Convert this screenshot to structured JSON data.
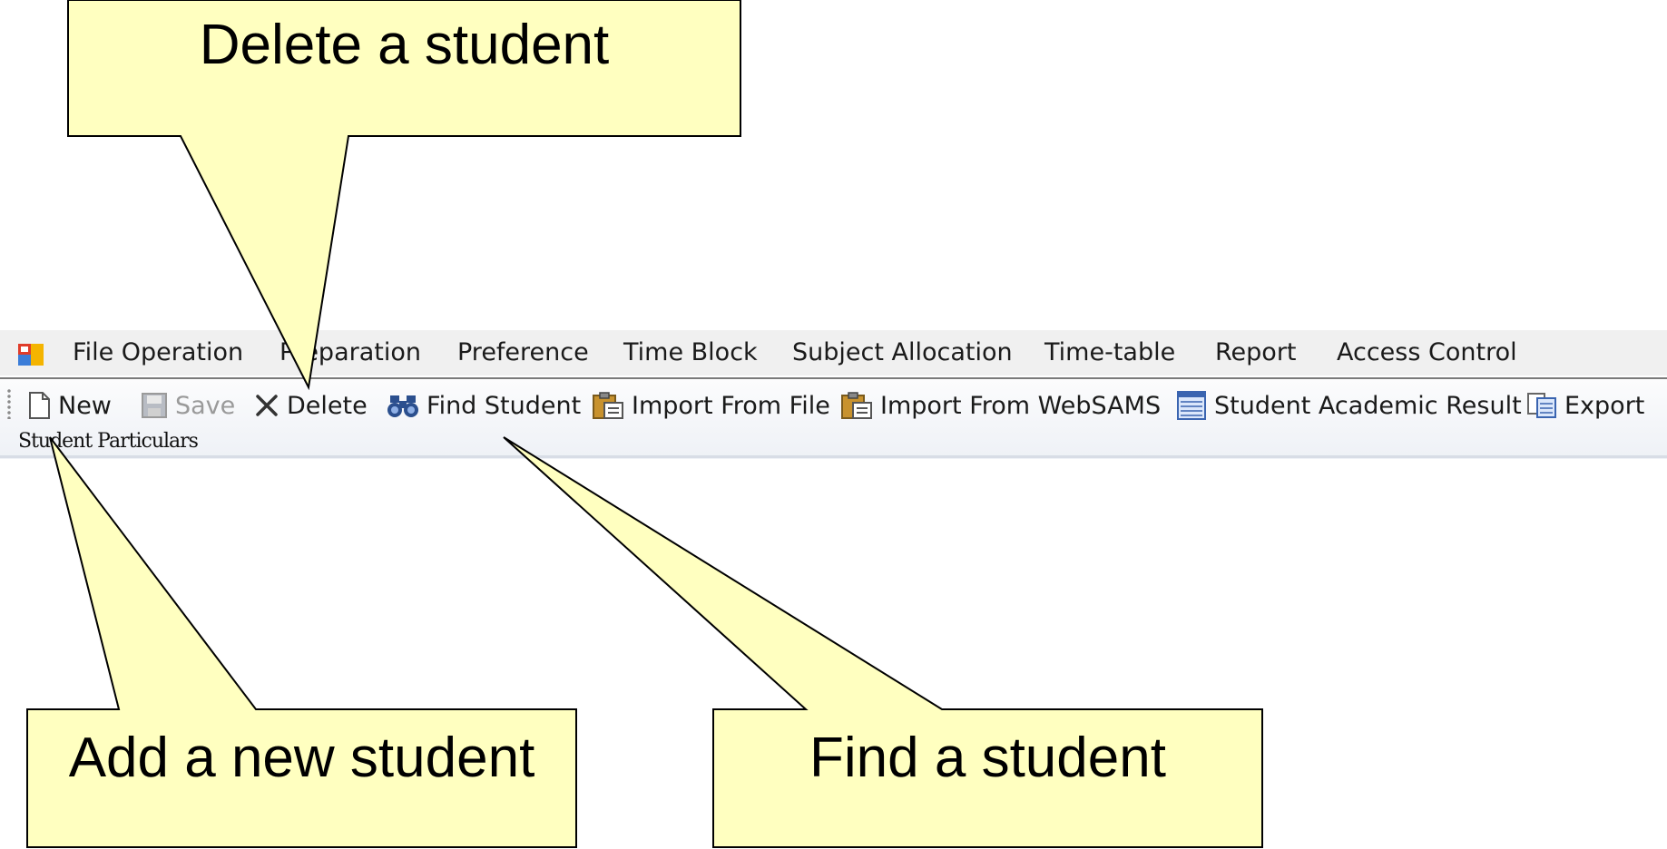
{
  "menu": {
    "items": [
      {
        "label": "File Operation"
      },
      {
        "label": "Preparation"
      },
      {
        "label": "Preference"
      },
      {
        "label": "Time Block"
      },
      {
        "label": "Subject Allocation"
      },
      {
        "label": "Time-table"
      },
      {
        "label": "Report"
      },
      {
        "label": "Access Control"
      }
    ]
  },
  "toolbar": {
    "new_label": "New",
    "save_label": "Save",
    "delete_label": "Delete",
    "find_label": "Find Student",
    "import_file_label": "Import From File",
    "import_websams_label": "Import From WebSAMS",
    "academic_result_label": "Student Academic Result",
    "export_label": "Export",
    "group_label": "Student Particulars"
  },
  "callouts": {
    "delete": "Delete a student",
    "add": "Add a new student",
    "find": "Find a student"
  },
  "colors": {
    "callout_fill": "#ffffc0",
    "menubar_bg": "#f0f0f0"
  }
}
